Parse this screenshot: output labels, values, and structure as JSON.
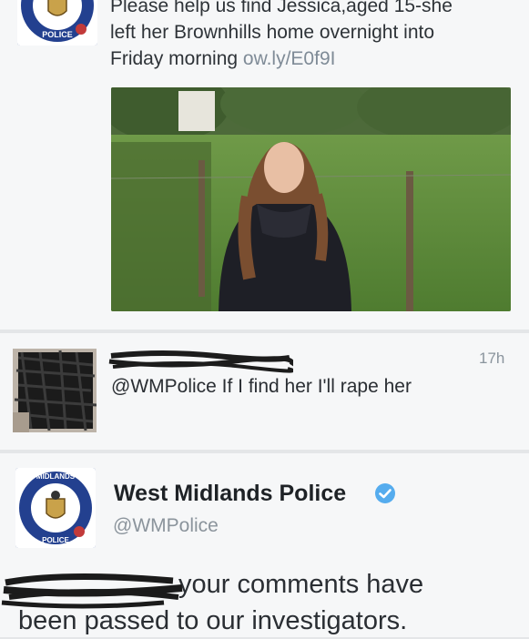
{
  "tweet1": {
    "text_line1": "Please help us find Jessica,aged 15-she",
    "text_line2": "left her Brownhills home overnight into",
    "text_line3": "Friday morning",
    "link": "ow.ly/E0f9I",
    "photo_alt": "missing person photo"
  },
  "reply1": {
    "time": "17h",
    "text": "@WMPolice If I find her I'll rape her"
  },
  "tweet2": {
    "name": "West Midlands Police",
    "handle": "@WMPolice",
    "text_line1": "your comments have",
    "text_line2": "been passed to our investigators."
  },
  "colors": {
    "card_bg": "#f6f7f8",
    "link": "#7f8b97",
    "verified": "#55acee",
    "badge_blue": "#1f3f8f"
  },
  "icons": {
    "avatar": "police-crest-icon",
    "verified": "verified-badge-icon"
  }
}
